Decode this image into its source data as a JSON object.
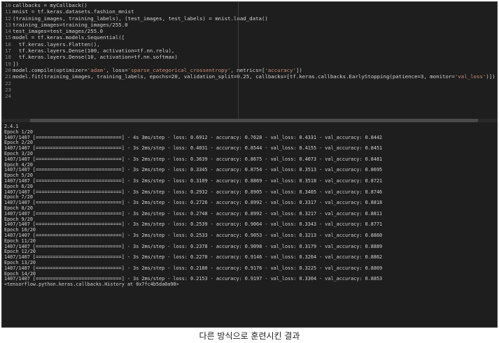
{
  "code_lines": [
    {
      "n": "10",
      "parts": [
        {
          "t": "callbacks = myCallback()"
        }
      ]
    },
    {
      "n": "11",
      "parts": [
        {
          "t": "mnist = tf.keras.datasets.fashion_mnist"
        }
      ]
    },
    {
      "n": "12",
      "parts": [
        {
          "t": "(training_images, training_labels), (test_images, test_labels) = mnist.load_data()"
        }
      ]
    },
    {
      "n": "13",
      "parts": [
        {
          "t": "training_images=training_images/255.0"
        }
      ]
    },
    {
      "n": "14",
      "parts": [
        {
          "t": "test_images=test_images/255.0"
        }
      ]
    },
    {
      "n": "15",
      "parts": [
        {
          "t": "model = tf.keras.models.Sequential(["
        }
      ]
    },
    {
      "n": "16",
      "parts": [
        {
          "t": "  tf.keras.layers.Flatten(),"
        }
      ]
    },
    {
      "n": "17",
      "parts": [
        {
          "t": "  tf.keras.layers.Dense(100, activation=tf.nn.relu),"
        }
      ]
    },
    {
      "n": "18",
      "parts": [
        {
          "t": "  tf.keras.layers.Dense(10, activation=tf.nn.softmax)"
        }
      ]
    },
    {
      "n": "19",
      "parts": [
        {
          "t": "])"
        }
      ]
    },
    {
      "n": "20",
      "parts": [
        {
          "t": "model.compile(optimizer="
        },
        {
          "t": "'adam'",
          "s": true
        },
        {
          "t": ", loss="
        },
        {
          "t": "'sparse_categorical_crossentropy'",
          "s": true
        },
        {
          "t": ", metrics=["
        },
        {
          "t": "'accuracy'",
          "s": true
        },
        {
          "t": "])"
        }
      ]
    },
    {
      "n": "21",
      "parts": [
        {
          "t": "model.fit(training_images, training_labels, epochs=20, validation_split=0.25, callbacks=[tf.keras.callbacks.EarlyStopping(patience=3, monitor="
        },
        {
          "t": "'val_loss'",
          "s": true
        },
        {
          "t": ")])"
        }
      ]
    },
    {
      "n": "22",
      "parts": [
        {
          "t": ""
        }
      ]
    },
    {
      "n": "23",
      "parts": [
        {
          "t": ""
        }
      ]
    },
    {
      "n": "24",
      "parts": [
        {
          "t": ""
        }
      ]
    }
  ],
  "output_lines": [
    "2.4.1",
    "Epoch 1/20",
    "1407/1407 [==============================] - 4s 3ms/step - loss: 0.6912 - accuracy: 0.7628 - val_loss: 0.4331 - val_accuracy: 0.8442",
    "Epoch 2/20",
    "1407/1407 [==============================] - 3s 2ms/step - loss: 0.4031 - accuracy: 0.8544 - val_loss: 0.4155 - val_accuracy: 0.8451",
    "Epoch 3/20",
    "1407/1407 [==============================] - 3s 2ms/step - loss: 0.3639 - accuracy: 0.8675 - val_loss: 0.4073 - val_accuracy: 0.8481",
    "Epoch 4/20",
    "1407/1407 [==============================] - 3s 2ms/step - loss: 0.3345 - accuracy: 0.8754 - val_loss: 0.3513 - val_accuracy: 0.8695",
    "Epoch 5/20",
    "1407/1407 [==============================] - 3s 2ms/step - loss: 0.3109 - accuracy: 0.8869 - val_loss: 0.3518 - val_accuracy: 0.8721",
    "Epoch 6/20",
    "1407/1407 [==============================] - 3s 2ms/step - loss: 0.2932 - accuracy: 0.8905 - val_loss: 0.3405 - val_accuracy: 0.8746",
    "Epoch 7/20",
    "1407/1407 [==============================] - 3s 2ms/step - loss: 0.2726 - accuracy: 0.8992 - val_loss: 0.3317 - val_accuracy: 0.8818",
    "Epoch 8/20",
    "1407/1407 [==============================] - 3s 2ms/step - loss: 0.2748 - accuracy: 0.8992 - val_loss: 0.3217 - val_accuracy: 0.8811",
    "Epoch 9/20",
    "1407/1407 [==============================] - 3s 2ms/step - loss: 0.2539 - accuracy: 0.9064 - val_loss: 0.3343 - val_accuracy: 0.8771",
    "Epoch 10/20",
    "1407/1407 [==============================] - 3s 2ms/step - loss: 0.2533 - accuracy: 0.9053 - val_loss: 0.3213 - val_accuracy: 0.8860",
    "Epoch 11/20",
    "1407/1407 [==============================] - 3s 2ms/step - loss: 0.2378 - accuracy: 0.9098 - val_loss: 0.3179 - val_accuracy: 0.8889",
    "Epoch 12/20",
    "1407/1407 [==============================] - 3s 2ms/step - loss: 0.2270 - accuracy: 0.9146 - val_loss: 0.3264 - val_accuracy: 0.8862",
    "Epoch 13/20",
    "1407/1407 [==============================] - 3s 2ms/step - loss: 0.2180 - accuracy: 0.9176 - val_loss: 0.3225 - val_accuracy: 0.8869",
    "Epoch 14/20",
    "1407/1407 [==============================] - 3s 2ms/step - loss: 0.2153 - accuracy: 0.9197 - val_loss: 0.3304 - val_accuracy: 0.8853",
    "<tensorflow.python.keras.callbacks.History at 0x7fc4b5da0a90>"
  ],
  "caption": "다른 방식으로 훈련시킨 결과",
  "colors": {
    "editor_bg": "#1e1e1e",
    "code_text": "#d4d4d4",
    "string": "#ce9178",
    "line_number": "#858585"
  }
}
